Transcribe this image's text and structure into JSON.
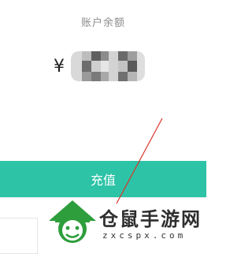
{
  "account": {
    "balance_label": "账户余额",
    "currency_symbol": "¥",
    "amount": "0.00"
  },
  "recharge_button": {
    "label": "充值",
    "color": "#2cc3a7"
  },
  "watermark": {
    "name": "仓鼠手游网",
    "url": "zxcspx.com"
  }
}
